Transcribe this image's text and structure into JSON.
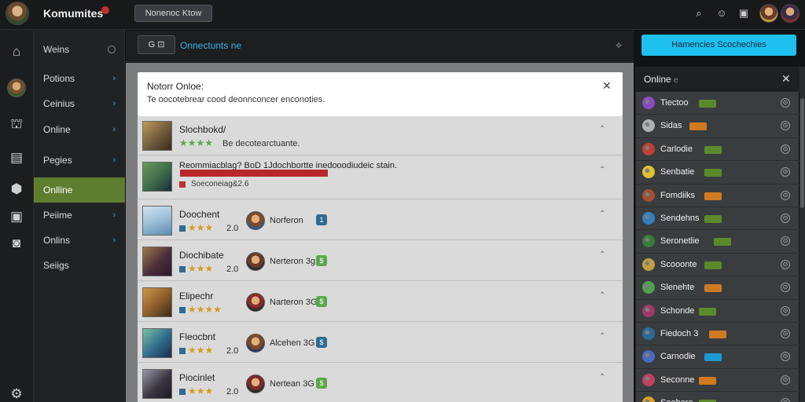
{
  "app": {
    "title": "Komumites",
    "top_button": "Nonenoc Ktow"
  },
  "top_icons": [
    "search-icon",
    "smiley-icon",
    "grid-icon"
  ],
  "nav": {
    "items": [
      {
        "label": "Weins",
        "marker": "ring"
      },
      {
        "label": "Potions",
        "marker": "chevron"
      },
      {
        "label": "Ceinius",
        "marker": "chevron"
      },
      {
        "label": "Online",
        "marker": "chevron"
      },
      {
        "label": "Pegies",
        "marker": "chevron"
      },
      {
        "label": "Onlline",
        "marker": "none",
        "active": true
      },
      {
        "label": "Peiime",
        "marker": "chevron"
      },
      {
        "label": "Onlins",
        "marker": "chevron"
      },
      {
        "label": "Seiigs",
        "marker": "none"
      }
    ]
  },
  "subbar": {
    "button_label": "G ⊡",
    "link_label": "Onnectunts ne"
  },
  "modal": {
    "title": "Notorr Onloe:",
    "description": "Te oocotebrear cood deonnconcer enconoties.",
    "close_glyph": "✕"
  },
  "list": [
    {
      "title": "Slochbokd/",
      "stars": "★★★★",
      "meta": "Be decotearctuante.",
      "type": "plain",
      "thumb_color": "#6e5a3a"
    },
    {
      "title": "Reommiacblag? BoD 1Jdochbortte inedooodiudeic stain.",
      "sub": "Soeconeiag&2.6",
      "type": "flag",
      "thumb_color": "#3d6a4a"
    },
    {
      "title": "Doochent",
      "stars": "★★★",
      "meta": "2.0",
      "author": "Norferon",
      "coin": "1",
      "type": "author",
      "thumb_color": "#9cc0d8",
      "coin_color": "#2f6b93"
    },
    {
      "title": "Diochibate",
      "stars": "★★★",
      "meta": "2.0",
      "author": "Nerteron 3g",
      "coin": "$",
      "type": "author",
      "thumb_color": "#4a2d3a",
      "coin_color": "#5aa84a"
    },
    {
      "title": "Elipechr",
      "stars": "★★★★",
      "meta": "",
      "author": "Narteron 3G",
      "coin": "$",
      "type": "author",
      "thumb_color": "#8a5a2a",
      "coin_color": "#5aa84a"
    },
    {
      "title": "Fleocbnt",
      "stars": "★★★",
      "meta": "2.0",
      "author": "Alcehen 3G",
      "coin": "$",
      "type": "author",
      "thumb_color": "#2f6a8a",
      "coin_color": "#2f6b93"
    },
    {
      "title": "Piocinlet",
      "stars": "★★★",
      "meta": "2.0",
      "author": "Nertean 3G",
      "coin": "$",
      "type": "author",
      "thumb_color": "#3a3540",
      "coin_color": "#5aa84a"
    }
  ],
  "cta_label": "Hamencies Scochechies",
  "online_panel": {
    "title": "Online",
    "title_suffix": "e",
    "items": [
      {
        "name": "Tiectoo",
        "tag_color": "#5b8a2a",
        "icon_color": "#8a4ac0"
      },
      {
        "name": "Sidas",
        "tag_color": "#d07a20",
        "icon_color": "#b0b0b0"
      },
      {
        "name": "Carlodie",
        "tag_color": "#5b8a2a",
        "icon_color": "#c04030"
      },
      {
        "name": "Senbatie",
        "tag_color": "#5b8a2a",
        "icon_color": "#e0c030"
      },
      {
        "name": "Fomdiiks",
        "tag_color": "#d07a20",
        "icon_color": "#a05030"
      },
      {
        "name": "Sendehns",
        "tag_color": "#5b8a2a",
        "icon_color": "#3080c0"
      },
      {
        "name": "Seronetlie",
        "tag_color": "#5b8a2a",
        "icon_color": "#3a7a3a"
      },
      {
        "name": "Scooonte",
        "tag_color": "#5b8a2a",
        "icon_color": "#c0a040"
      },
      {
        "name": "Slenehte",
        "tag_color": "#d07a20",
        "icon_color": "#50a050"
      },
      {
        "name": "Schonde",
        "tag_color": "#5b8a2a",
        "icon_color": "#a03a6a"
      },
      {
        "name": "Fiedoch 3",
        "tag_color": "#d07a20",
        "icon_color": "#2a6a9a"
      },
      {
        "name": "Carnodie",
        "tag_color": "#1a9ad0",
        "icon_color": "#4a6ac0"
      },
      {
        "name": "Seconne",
        "tag_color": "#d07a20",
        "icon_color": "#c04060"
      },
      {
        "name": "Soohore",
        "tag_color": "#5b8a2a",
        "icon_color": "#e0a020"
      }
    ]
  }
}
